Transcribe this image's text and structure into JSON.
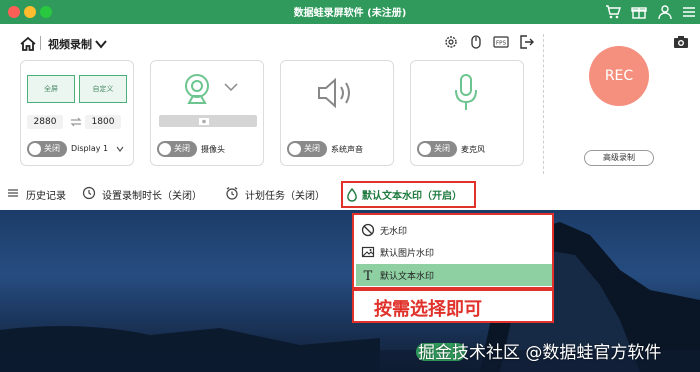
{
  "window": {
    "title": "数据蛙录屏软件 (未注册)"
  },
  "header": {
    "mode": "视频录制"
  },
  "screen_card": {
    "full_label": "全屏",
    "custom_label": "自定义",
    "width": "2880",
    "height": "1800",
    "toggle": "关闭",
    "display": "Display 1"
  },
  "camera_card": {
    "toggle": "关闭",
    "label": "摄像头"
  },
  "system_audio_card": {
    "toggle": "关闭",
    "label": "系统声音"
  },
  "mic_card": {
    "toggle": "关闭",
    "label": "麦克风"
  },
  "rec": {
    "label": "REC",
    "advanced": "高级录制"
  },
  "toolbar": {
    "history": "历史记录",
    "duration": "设置录制时长（关闭）",
    "schedule": "计划任务（关闭）",
    "watermark": "默认文本水印（开启）"
  },
  "watermark_menu": {
    "items": [
      {
        "label": "无水印",
        "icon": "no-icon"
      },
      {
        "label": "默认图片水印",
        "icon": "image-icon"
      },
      {
        "label": "默认文本水印",
        "icon": "text-icon"
      }
    ],
    "selected_index": 2
  },
  "annotation": "按需选择即可",
  "overlay_watermark": "掘金技术社区 @数据蛙官方软件",
  "colors": {
    "brand_green": "#2f9a5b",
    "rec": "#f5907e",
    "highlight": "#e0312b"
  }
}
